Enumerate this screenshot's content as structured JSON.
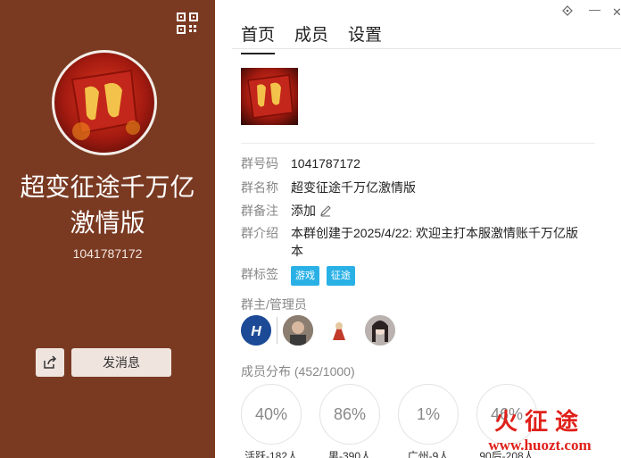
{
  "left": {
    "group_name": "超变征途千万亿激情版",
    "group_id": "1041787172",
    "send_message": "发消息",
    "bg_color": "#7a3a22"
  },
  "window": {
    "pin_icon": "pin-icon",
    "minimize": "—",
    "close": "✕"
  },
  "tabs": [
    {
      "label": "首页",
      "active": true
    },
    {
      "label": "成员",
      "active": false
    },
    {
      "label": "设置",
      "active": false
    }
  ],
  "info": {
    "id_label": "群号码",
    "id_value": "1041787172",
    "name_label": "群名称",
    "name_value": "超变征途千万亿激情版",
    "note_label": "群备注",
    "note_value": "添加",
    "intro_label": "群介绍",
    "intro_value": "本群创建于2025/4/22: 欢迎主打本服激情账千万亿版本",
    "tags_label": "群标签",
    "tags": [
      "游戏",
      "征途"
    ]
  },
  "admins_label": "群主/管理员",
  "members_dist": {
    "title": "成员分布",
    "count": "(452/1000)",
    "stats": [
      {
        "value": "40%",
        "label": "活跃-182人"
      },
      {
        "value": "86%",
        "label": "男-390人"
      },
      {
        "value": "1%",
        "label": "广州-9人"
      },
      {
        "value": "46%",
        "label": "90后-208人"
      }
    ]
  },
  "watermark": {
    "line1": "火征途",
    "line2": "www.huozt.com"
  }
}
